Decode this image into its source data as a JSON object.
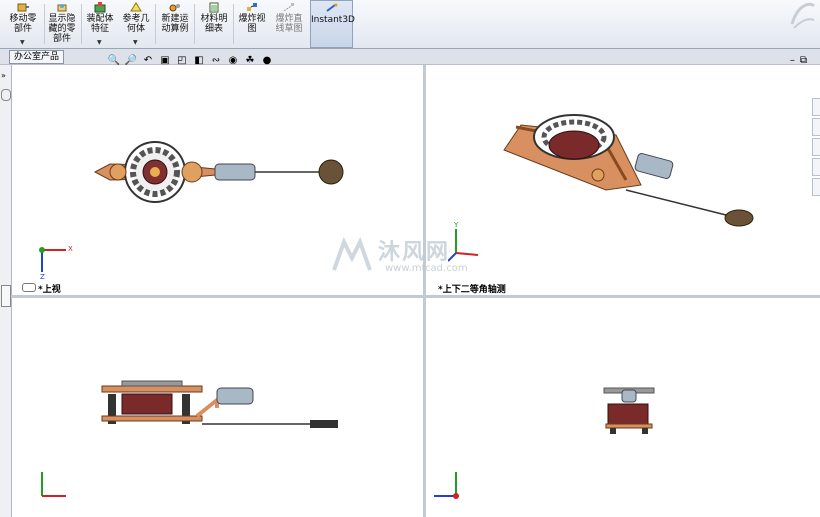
{
  "toolbar": {
    "buttons": [
      {
        "label": "移动零\n部件",
        "icon": "move-component-icon",
        "dropdown": true
      },
      {
        "label": "显示隐\n藏的零\n部件",
        "icon": "show-hidden-icon",
        "dropdown": false
      },
      {
        "label": "装配体\n特征",
        "icon": "assembly-feature-icon",
        "dropdown": true
      },
      {
        "label": "参考几\n何体",
        "icon": "reference-geometry-icon",
        "dropdown": true
      },
      {
        "label": "新建运\n动算例",
        "icon": "motion-study-icon",
        "dropdown": false
      },
      {
        "label": "材料明\n细表",
        "icon": "bom-icon",
        "dropdown": false
      },
      {
        "label": "爆炸视\n图",
        "icon": "explode-view-icon",
        "dropdown": false
      },
      {
        "label": "爆炸直\n线草图",
        "icon": "explode-line-icon",
        "dropdown": false
      },
      {
        "label": "Instant3D",
        "icon": "instant3d-icon",
        "dropdown": false
      }
    ]
  },
  "tab": {
    "label": "办公室产品"
  },
  "viewports": {
    "top_left": {
      "label": "*上视"
    },
    "top_right": {
      "label": "*上下二等角轴测"
    },
    "bottom_left": {
      "label": ""
    },
    "bottom_right": {
      "label": ""
    }
  },
  "triad": {
    "x": "X",
    "y": "Y",
    "z": "Z"
  },
  "watermark": {
    "text": "沐风网",
    "url": "www.mfcad.com"
  },
  "colors": {
    "x_axis": "#d42020",
    "y_axis": "#20a020",
    "z_axis": "#2040d0",
    "accent": "#3a6fc8"
  }
}
